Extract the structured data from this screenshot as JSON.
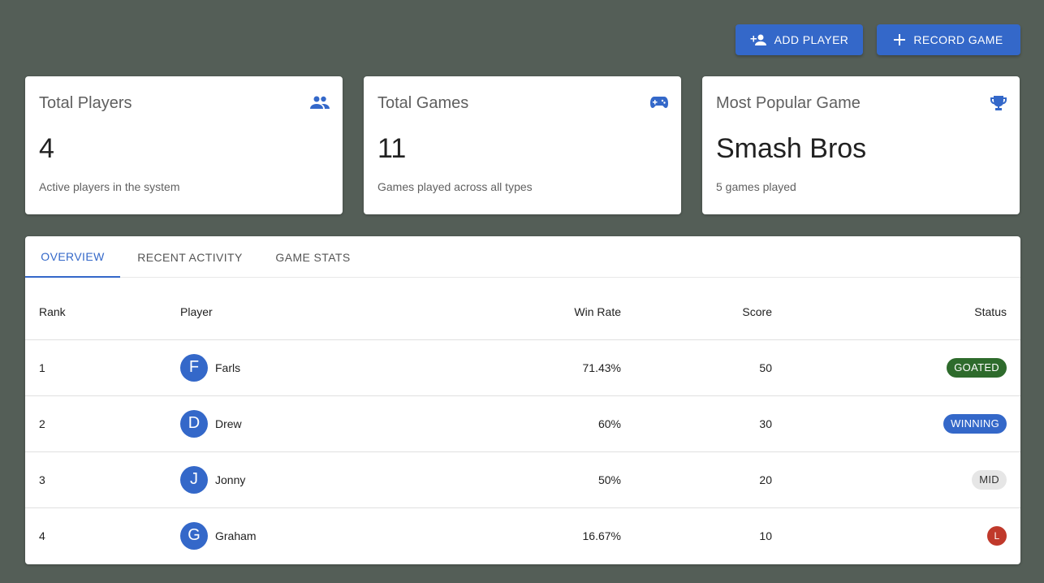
{
  "actions": {
    "add_player": "ADD PLAYER",
    "record_game": "RECORD GAME"
  },
  "cards": [
    {
      "title": "Total Players",
      "value": "4",
      "subtitle": "Active players in the system",
      "icon": "people-icon"
    },
    {
      "title": "Total Games",
      "value": "11",
      "subtitle": "Games played across all types",
      "icon": "gamepad-icon"
    },
    {
      "title": "Most Popular Game",
      "value": "Smash Bros",
      "subtitle": "5 games played",
      "icon": "trophy-icon"
    }
  ],
  "tabs": [
    {
      "label": "OVERVIEW",
      "active": true
    },
    {
      "label": "RECENT ACTIVITY",
      "active": false
    },
    {
      "label": "GAME STATS",
      "active": false
    }
  ],
  "table": {
    "headers": {
      "rank": "Rank",
      "player": "Player",
      "win_rate": "Win Rate",
      "score": "Score",
      "status": "Status"
    },
    "rows": [
      {
        "rank": "1",
        "initial": "F",
        "name": "Farls",
        "win_rate": "71.43%",
        "score": "50",
        "status": "GOATED"
      },
      {
        "rank": "2",
        "initial": "D",
        "name": "Drew",
        "win_rate": "60%",
        "score": "30",
        "status": "WINNING"
      },
      {
        "rank": "3",
        "initial": "J",
        "name": "Jonny",
        "win_rate": "50%",
        "score": "20",
        "status": "MID"
      },
      {
        "rank": "4",
        "initial": "G",
        "name": "Graham",
        "win_rate": "16.67%",
        "score": "10",
        "status": "L"
      }
    ]
  },
  "colors": {
    "background": "#545e57",
    "accent": "#3468c9",
    "goated": "#2e6b2c",
    "loss": "#c0392b"
  }
}
